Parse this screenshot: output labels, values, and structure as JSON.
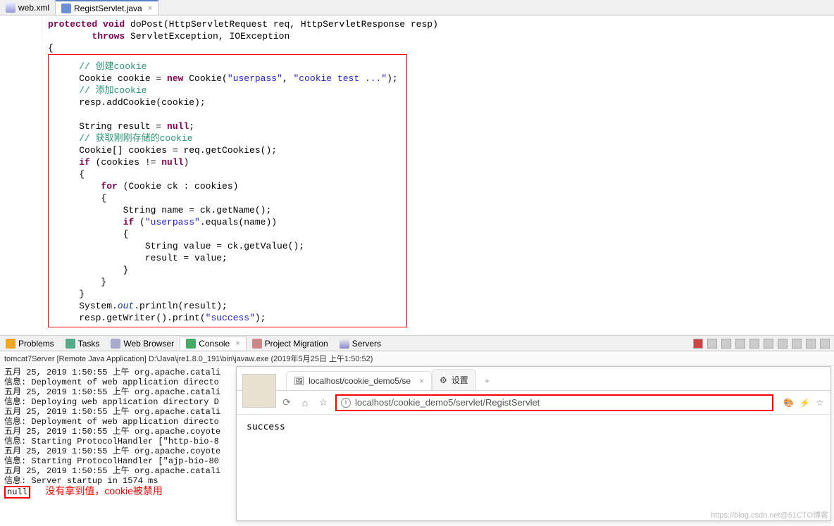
{
  "editor_tabs": [
    {
      "label": "web.xml",
      "active": false
    },
    {
      "label": "RegistServlet.java",
      "active": true
    }
  ],
  "code": {
    "sig1_keywords": "protected void",
    "sig1_rest": " doPost(HttpServletRequest req, HttpServletResponse resp)",
    "throws_kw": "throws",
    "throws_rest": " ServletException, IOException",
    "open_brace": "{",
    "c1": "// 创建cookie",
    "l2a": "Cookie cookie = ",
    "l2_new": "new",
    "l2b": " Cookie(",
    "l2_s1": "\"userpass\"",
    "l2c": ", ",
    "l2_s2": "\"cookie test ...\"",
    "l2d": ");",
    "c2": "// 添加cookie",
    "l3": "resp.addCookie(cookie);",
    "l4a": "String result = ",
    "l4_null": "null",
    "l4b": ";",
    "c3": "// 获取刚刚存储的cookie",
    "l5": "Cookie[] cookies = req.getCookies();",
    "l6_if": "if",
    "l6_rest": " (cookies != ",
    "l6_null": "null",
    "l6_close": ")",
    "ob": "{",
    "l7_for": "for",
    "l7_rest": " (Cookie ck : cookies)",
    "l8": "String name = ck.getName();",
    "l9_if": "if",
    "l9_a": " (",
    "l9_s": "\"userpass\"",
    "l9_b": ".equals(name))",
    "l10": "String value = ck.getValue();",
    "l11": "result = value;",
    "cb": "}",
    "l12a": "System.",
    "l12_out": "out",
    "l12b": ".println(result);",
    "l13a": "resp.getWriter().print(",
    "l13_s": "\"success\"",
    "l13b": ");"
  },
  "bottom_tabs": {
    "problems": "Problems",
    "tasks": "Tasks",
    "web": "Web Browser",
    "console": "Console",
    "proj": "Project Migration",
    "servers": "Servers"
  },
  "console": {
    "header": "tomcat7Server [Remote Java Application] D:\\Java\\jre1.8.0_191\\bin\\javaw.exe (2019年5月25日 上午1:50:52)",
    "lines": [
      "五月 25, 2019 1:50:55 上午 org.apache.catali",
      "信息: Deployment of web application directo",
      "五月 25, 2019 1:50:55 上午 org.apache.catali",
      "信息: Deploying web application directory D",
      "五月 25, 2019 1:50:55 上午 org.apache.catali",
      "信息: Deployment of web application directo",
      "五月 25, 2019 1:50:55 上午 org.apache.coyote",
      "信息: Starting ProtocolHandler [\"http-bio-8",
      "五月 25, 2019 1:50:55 上午 org.apache.coyote",
      "信息: Starting ProtocolHandler [\"ajp-bio-80",
      "五月 25, 2019 1:50:55 上午 org.apache.catali",
      "信息: Server startup in 1574 ms"
    ],
    "null_value": "null",
    "note": "没有拿到值，cookie被禁用"
  },
  "browser": {
    "tab1": "localhost/cookie_demo5/se",
    "tab2": "设置",
    "url": "localhost/cookie_demo5/servlet/RegistServlet",
    "body": "success"
  },
  "watermark": "https://blog.csdn.net@51CTO博客"
}
